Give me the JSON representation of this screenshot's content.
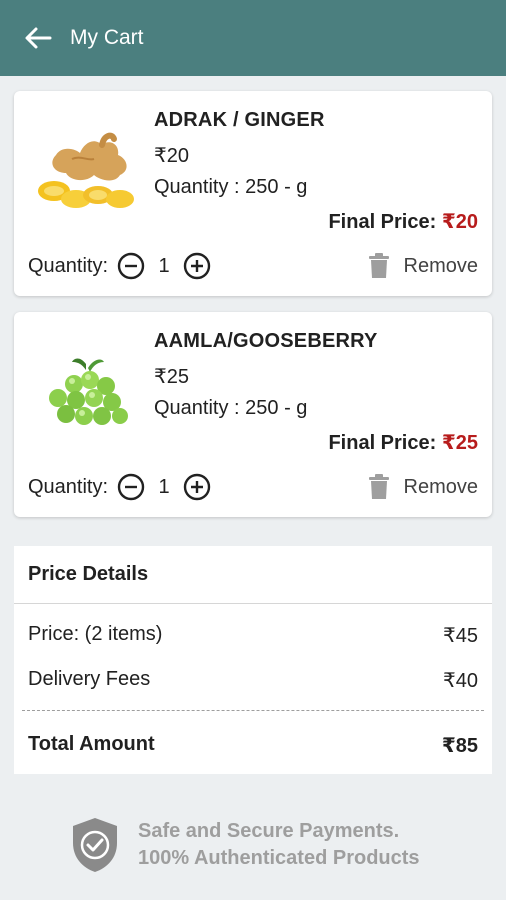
{
  "header": {
    "title": "My Cart",
    "back_icon": "arrow-left-icon",
    "background": "#4b7f7f"
  },
  "cart": {
    "items": [
      {
        "name": "ADRAK / GINGER",
        "price": "₹20",
        "quantity_text": "Quantity : 250 - g",
        "final_label": "Final Price: ",
        "final_price": "₹20",
        "qty_label": "Quantity:",
        "qty": "1",
        "remove_label": "Remove",
        "image": "ginger-image"
      },
      {
        "name": "AAMLA/GOOSEBERRY",
        "price": "₹25",
        "quantity_text": "Quantity : 250 - g",
        "final_label": "Final Price: ",
        "final_price": "₹25",
        "qty_label": "Quantity:",
        "qty": "1",
        "remove_label": "Remove",
        "image": "gooseberry-image"
      }
    ]
  },
  "price_details": {
    "title": "Price Details",
    "price_label": "Price: (2 items)",
    "price_value": "₹45",
    "delivery_label": "Delivery Fees",
    "delivery_value": "₹40",
    "total_label": "Total Amount",
    "total_value": "₹85"
  },
  "secure": {
    "icon": "shield-check-icon",
    "line1": "Safe and Secure Payments.",
    "line2": "100% Authenticated Products"
  },
  "colors": {
    "accent": "#4b7f7f",
    "final_price": "#b71c1c",
    "muted": "#9e9e9e"
  }
}
